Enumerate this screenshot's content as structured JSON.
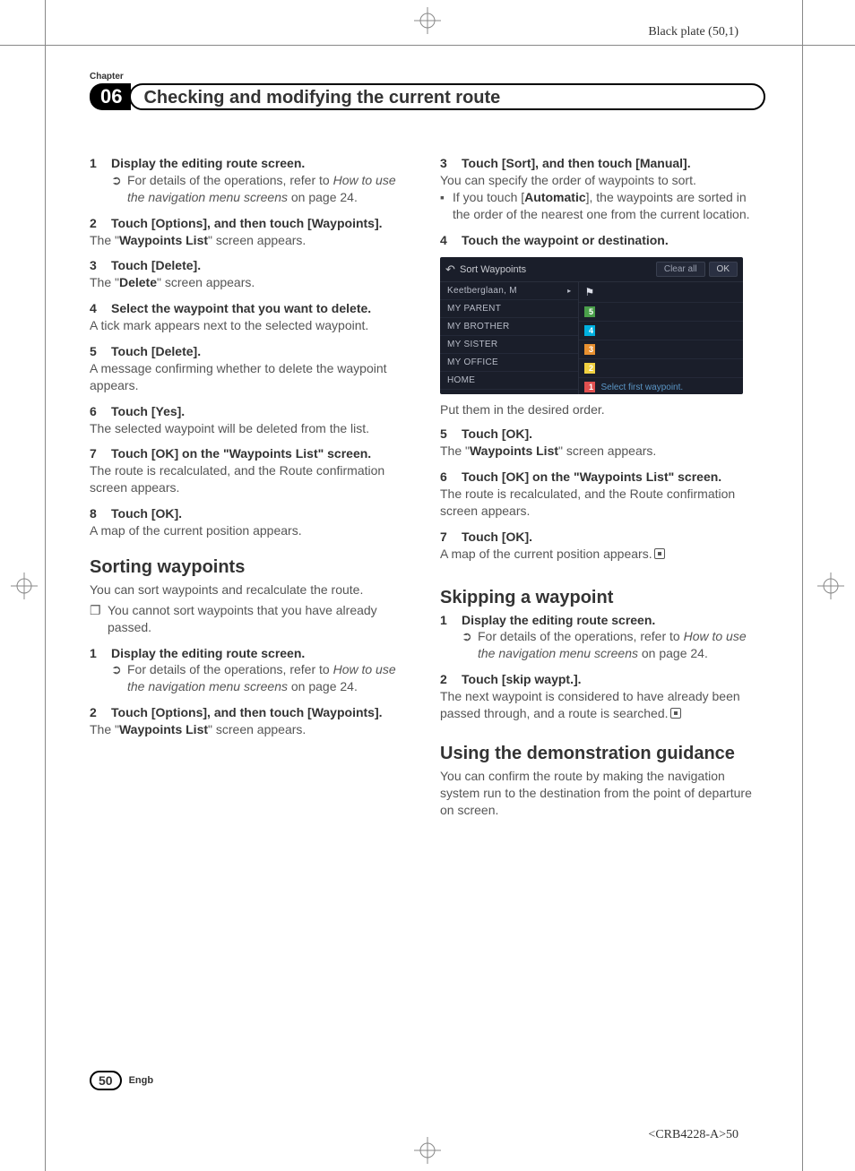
{
  "meta": {
    "black_plate": "Black plate (50,1)",
    "crb": "<CRB4228-A>50"
  },
  "header": {
    "chapter_label": "Chapter",
    "chapter_num": "06",
    "chapter_title": "Checking and modifying the current route"
  },
  "left": {
    "steps_a": [
      {
        "num": "1",
        "title": "Display the editing route screen.",
        "note_icon": "➲",
        "note_text_a": "For details of the operations, refer to ",
        "note_ref": "How to use the navigation menu screens",
        "note_text_b": " on page 24."
      },
      {
        "num": "2",
        "title": "Touch [Options], and then touch [Waypoints].",
        "body_a": "The \"",
        "body_bold": "Waypoints List",
        "body_b": "\" screen appears."
      },
      {
        "num": "3",
        "title": "Touch [Delete].",
        "body_a": "The \"",
        "body_bold": "Delete",
        "body_b": "\" screen appears."
      },
      {
        "num": "4",
        "title": "Select the waypoint that you want to delete.",
        "body": "A tick mark appears next to the selected waypoint."
      },
      {
        "num": "5",
        "title": "Touch [Delete].",
        "body": "A message confirming whether to delete the waypoint appears."
      },
      {
        "num": "6",
        "title": "Touch [Yes].",
        "body": "The selected waypoint will be deleted from the list."
      },
      {
        "num": "7",
        "title": "Touch [OK] on the \"Waypoints List\" screen.",
        "body": "The route is recalculated, and the Route confirmation screen appears."
      },
      {
        "num": "8",
        "title": "Touch [OK].",
        "body": "A map of the current position appears."
      }
    ],
    "sorting": {
      "heading": "Sorting waypoints",
      "intro": "You can sort waypoints and recalculate the route.",
      "sq_icon": "❐",
      "sq_text": "You cannot sort waypoints that you have already passed.",
      "steps": [
        {
          "num": "1",
          "title": "Display the editing route screen.",
          "note_icon": "➲",
          "note_text_a": "For details of the operations, refer to ",
          "note_ref": "How to use the navigation menu screens",
          "note_text_b": " on page 24."
        },
        {
          "num": "2",
          "title": "Touch [Options], and then touch [Waypoints].",
          "body_a": "The \"",
          "body_bold": "Waypoints List",
          "body_b": "\" screen appears."
        }
      ]
    }
  },
  "right": {
    "sorting_cont": [
      {
        "num": "3",
        "title": "Touch [Sort], and then touch [Manual].",
        "body": "You can specify the order of waypoints to sort.",
        "bullet_icon": "▪",
        "bullet_a": "If you touch [",
        "bullet_bold": "Automatic",
        "bullet_b": "], the waypoints are sorted in the order of the nearest one from the current location."
      },
      {
        "num": "4",
        "title": "Touch the waypoint or destination."
      }
    ],
    "screenshot": {
      "title": "Sort Waypoints",
      "clear": "Clear all",
      "ok": "OK",
      "rows": [
        "Keetberglaan, M",
        "MY PARENT",
        "MY BROTHER",
        "MY SISTER",
        "MY OFFICE",
        "HOME"
      ],
      "hint": "Select first waypoint."
    },
    "after_ss": "Put them in the desired order.",
    "sorting_cont2": [
      {
        "num": "5",
        "title": "Touch [OK].",
        "body_a": "The \"",
        "body_bold": "Waypoints List",
        "body_b": "\" screen appears."
      },
      {
        "num": "6",
        "title": "Touch [OK] on the \"Waypoints List\" screen.",
        "body": "The route is recalculated, and the Route confirmation screen appears."
      },
      {
        "num": "7",
        "title": "Touch [OK].",
        "body": "A map of the current position appears."
      }
    ],
    "skipping": {
      "heading": "Skipping a waypoint",
      "steps": [
        {
          "num": "1",
          "title": "Display the editing route screen.",
          "note_icon": "➲",
          "note_text_a": "For details of the operations, refer to ",
          "note_ref": "How to use the navigation menu screens",
          "note_text_b": " on page 24."
        },
        {
          "num": "2",
          "title": "Touch [skip waypt.].",
          "body": "The next waypoint is considered to have already been passed through, and a route is searched."
        }
      ]
    },
    "demo": {
      "heading": "Using the demonstration guidance",
      "intro": "You can confirm the route by making the navigation system run to the destination from the point of departure on screen."
    }
  },
  "footer": {
    "page": "50",
    "engb": "Engb"
  }
}
